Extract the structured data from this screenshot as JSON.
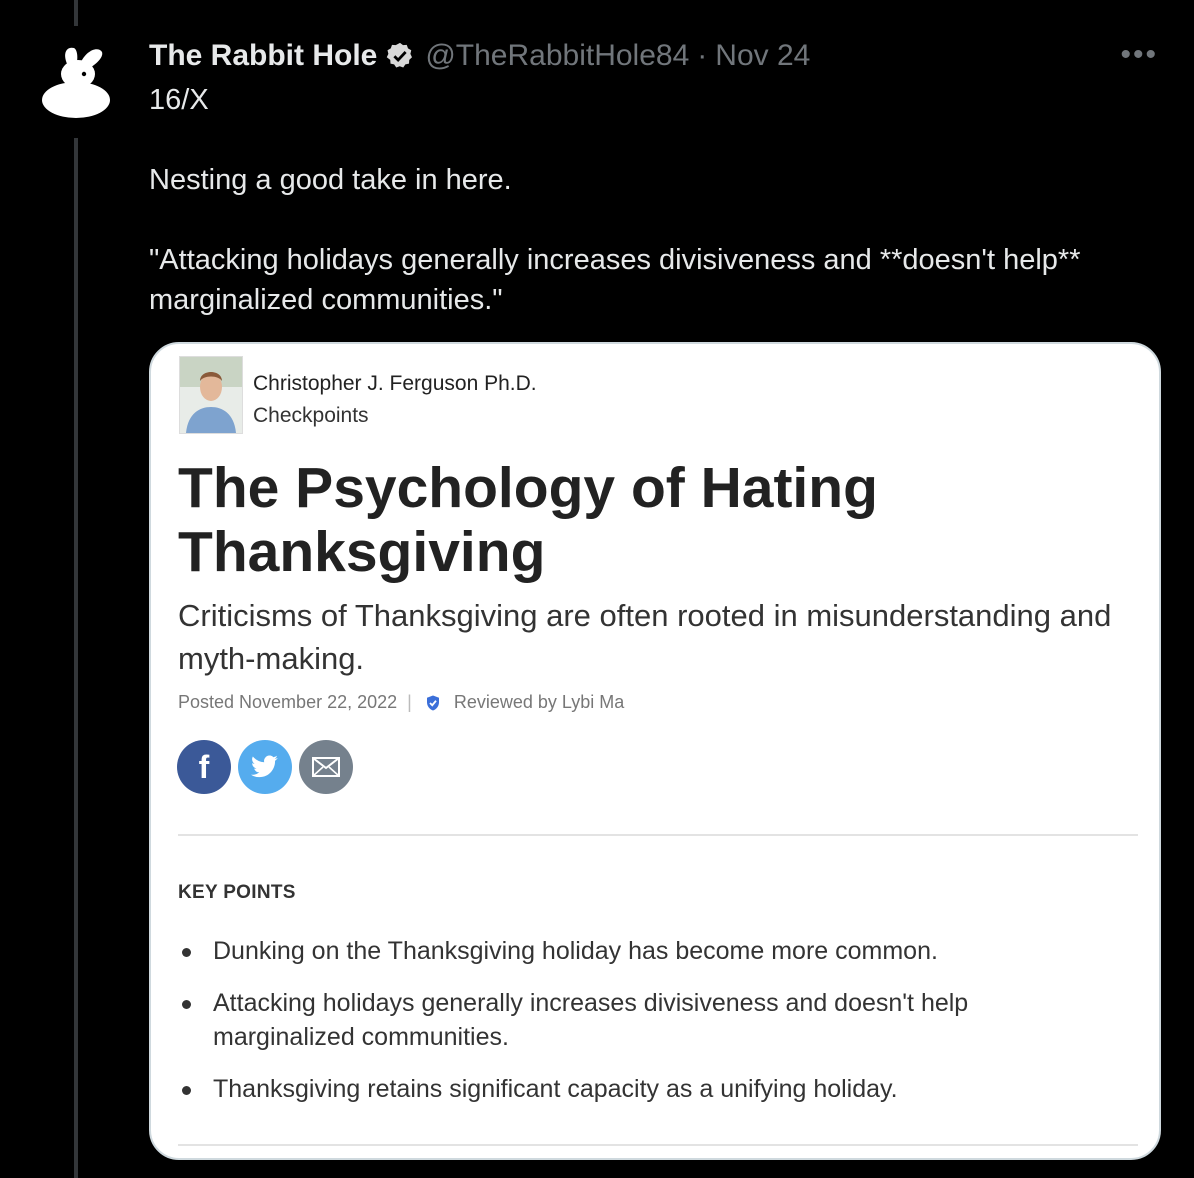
{
  "tweet": {
    "author_name": "The Rabbit Hole",
    "handle": "@TheRabbitHole84",
    "separator": "·",
    "date": "Nov 24",
    "more_label": "•••",
    "text": "16/X\n\nNesting a good take in here.\n\n\"Attacking holidays generally increases divisiveness and **doesn't help** marginalized communities.\""
  },
  "card": {
    "author": "Christopher J. Ferguson Ph.D.",
    "blog": "Checkpoints",
    "title": "The Psychology of Hating Thanksgiving",
    "subtitle": "Criticisms of Thanksgiving are often rooted in misunderstanding and myth-making.",
    "posted": "Posted November 22, 2022",
    "meta_separator": "|",
    "reviewed": "Reviewed by Lybi Ma",
    "key_points_heading": "KEY POINTS",
    "key_points": [
      "Dunking on the Thanksgiving holiday has become more common.",
      "Attacking holidays generally increases divisiveness and doesn't help marginalized communities.",
      "Thanksgiving retains significant capacity as a unifying holiday."
    ]
  },
  "icons": {
    "avatar": "rabbit-icon",
    "verified": "verified-badge-icon",
    "reviewed": "shield-check-icon",
    "share": [
      "facebook-icon",
      "twitter-icon",
      "email-icon"
    ]
  },
  "colors": {
    "background": "#000000",
    "muted_text": "#71767b",
    "facebook": "#3b5998",
    "twitter": "#55acee",
    "email": "#75818d"
  }
}
